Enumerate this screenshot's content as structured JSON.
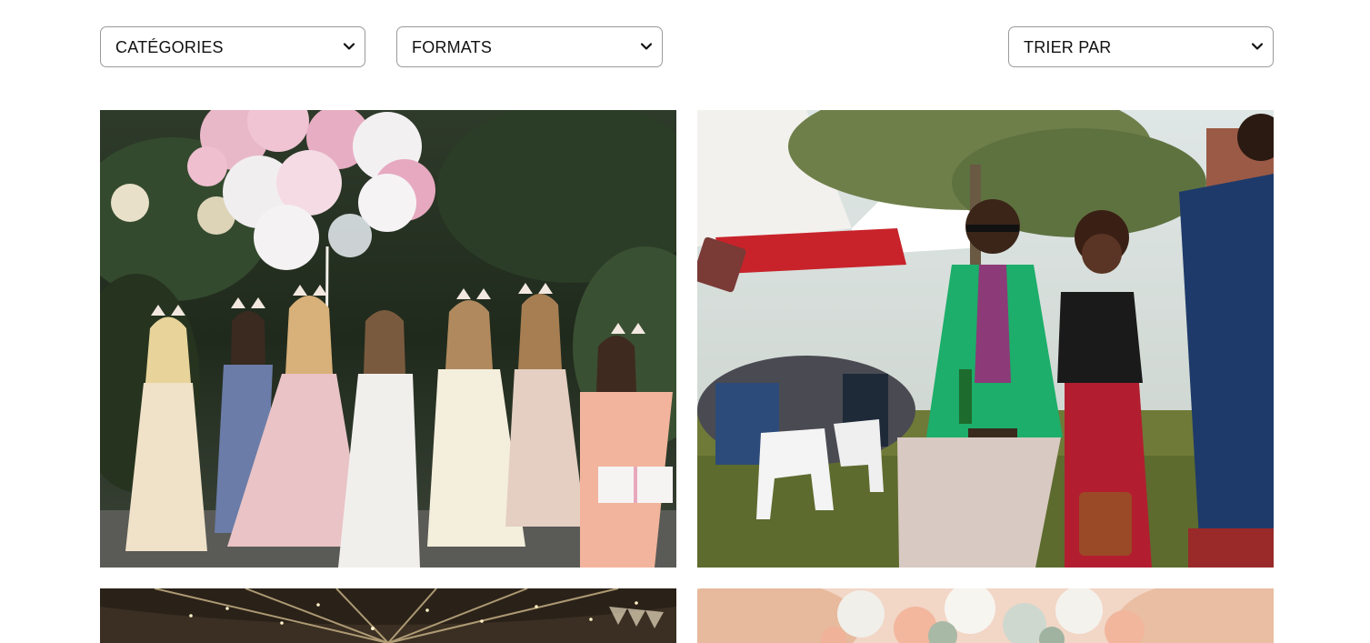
{
  "filters": {
    "categories": {
      "label": "CATÉGORIES"
    },
    "formats": {
      "label": "FORMATS"
    },
    "sort": {
      "label": "TRIER PAR"
    }
  },
  "icons": {
    "dropdown": "chevron-down-icon"
  },
  "gallery": {
    "items": [
      {
        "subject": "bridal-party-with-balloons"
      },
      {
        "subject": "outdoor-garden-party"
      },
      {
        "subject": "tent-interior-string-lights"
      },
      {
        "subject": "flower-bouquet"
      }
    ]
  }
}
